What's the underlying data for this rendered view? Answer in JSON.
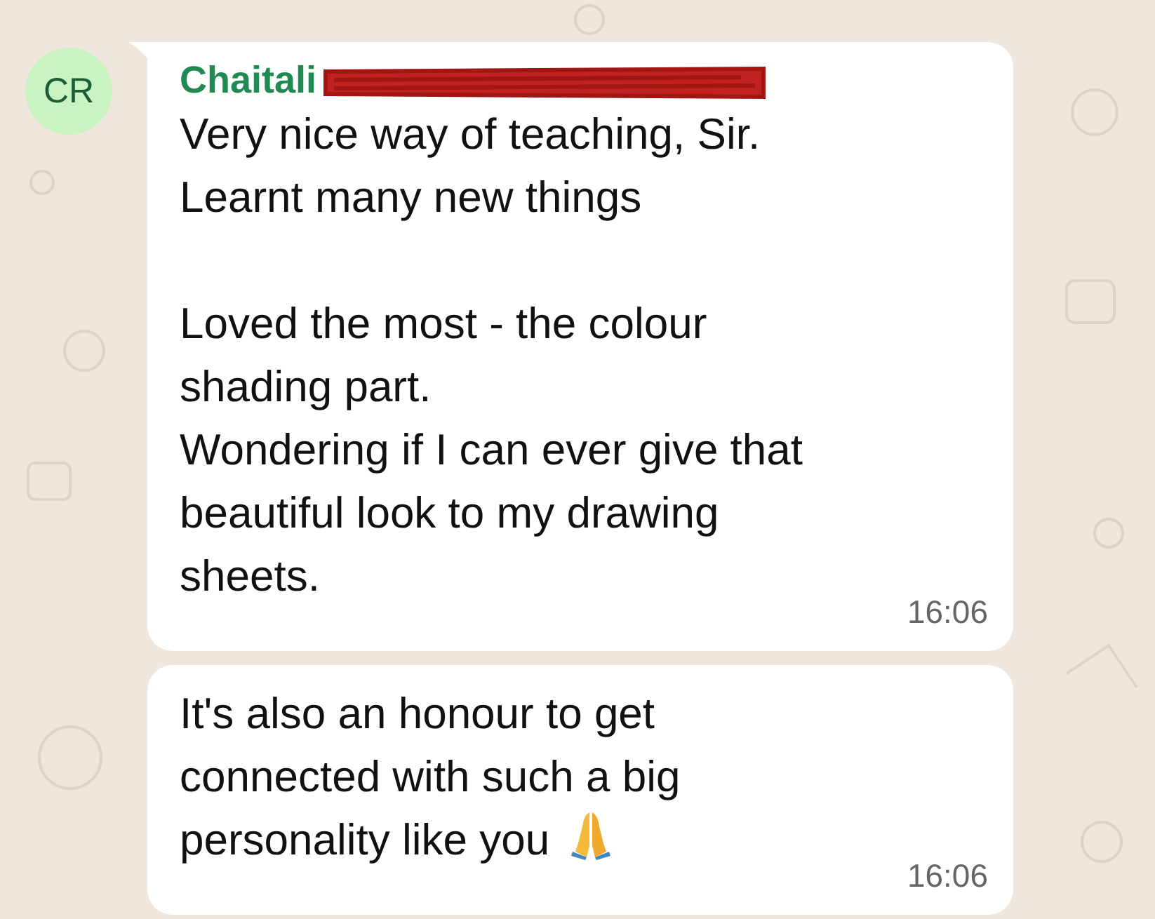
{
  "messages": [
    {
      "avatar": "CR",
      "sender": "Chaitali",
      "redacted": true,
      "text": "Very nice way of teaching, Sir.\nLearnt many new things\n\nLoved the most - the colour\nshading part.\nWondering if I can ever give that\nbeautiful look to my drawing\nsheets.",
      "time": "16:06"
    },
    {
      "text": "It's also an honour to get\nconnected with such a big\npersonality like you",
      "time": "16:06",
      "praying_hands_emoji": true
    }
  ]
}
